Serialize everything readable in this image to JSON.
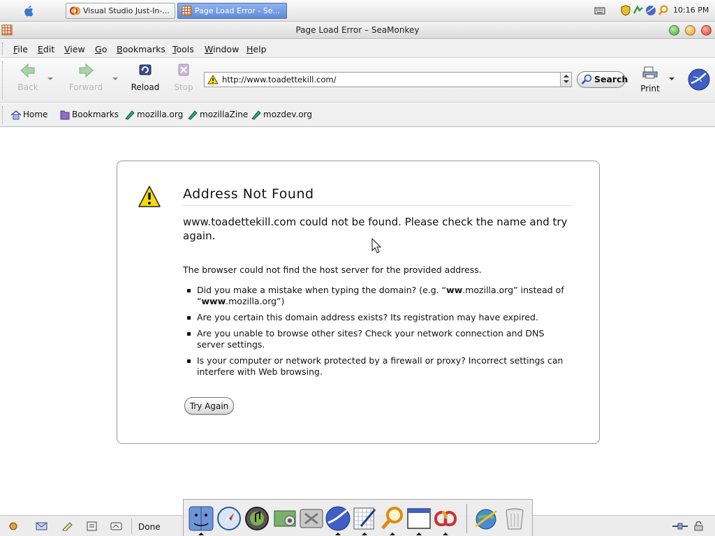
{
  "os": {
    "tasks": [
      {
        "label": "Visual Studio Just-In-...",
        "active": false
      },
      {
        "label": "Page Load Error - Se...",
        "active": true
      }
    ],
    "tray_icons": [
      "shield-icon",
      "network-icon",
      "clock-app-icon",
      "browser-icon",
      "search-icon"
    ],
    "clock": "10:16 PM"
  },
  "window": {
    "title": "Page Load Error – SeaMonkey"
  },
  "menu": [
    "File",
    "Edit",
    "View",
    "Go",
    "Bookmarks",
    "Tools",
    "Window",
    "Help"
  ],
  "toolbar": {
    "back_label": "Back",
    "forward_label": "Forward",
    "reload_label": "Reload",
    "stop_label": "Stop",
    "url_value": "http://www.toadettekill.com/",
    "search_label": "Search",
    "print_label": "Print"
  },
  "personal_toolbar": {
    "home_label": "Home",
    "bookmarks_label": "Bookmarks",
    "links": [
      "mozilla.org",
      "mozillaZine",
      "mozdev.org"
    ]
  },
  "error": {
    "title": "Address Not Found",
    "short_desc": "www.toadettekill.com could not be found. Please check the name and try again.",
    "long_desc": "The browser could not find the host server for the provided address.",
    "bullets": {
      "b1_pre": "Did you make a mistake when typing the domain? (e.g. “",
      "b1_bold1": "ww",
      "b1_mid1": ".mozilla.org” instead of “",
      "b1_bold2": "www",
      "b1_post": ".mozilla.org”)",
      "b2": "Are you certain this domain address exists? Its registration may have expired.",
      "b3": "Are you unable to browse other sites? Check your network connection and DNS server settings.",
      "b4": "Is your computer or network protected by a firewall or proxy? Incorrect settings can interfere with Web browsing."
    },
    "try_again_label": "Try Again"
  },
  "status": {
    "text": "Done"
  },
  "dock": {
    "icons": [
      "finder-icon",
      "safari-icon",
      "itunes-icon",
      "iphoto-icon",
      "system-prefs-icon",
      "seamonkey-icon",
      "textedit-icon",
      "sherlock-icon",
      "terminal-window-icon",
      "visual-studio-icon",
      "internet-connect-icon",
      "trash-icon"
    ]
  },
  "colors": {
    "accent": "#5f8bd8",
    "warning_yellow": "#f5d90a"
  }
}
